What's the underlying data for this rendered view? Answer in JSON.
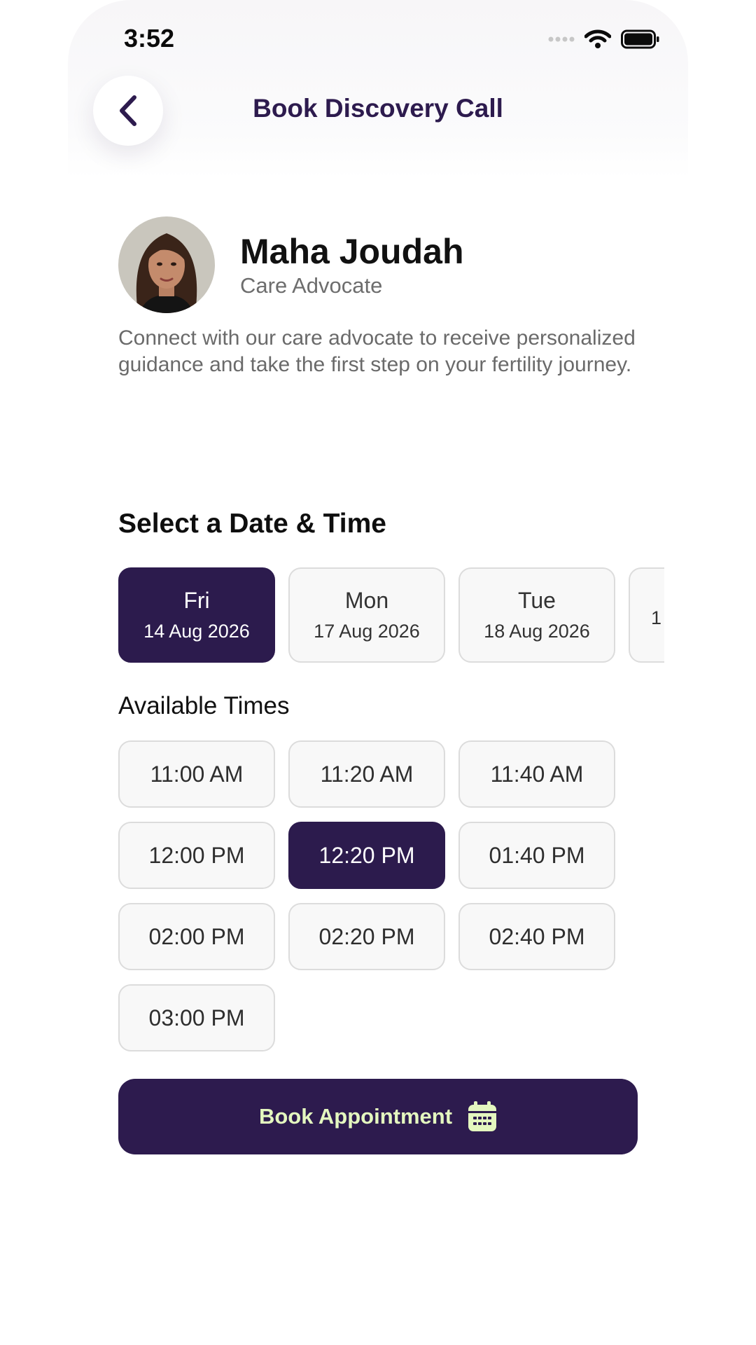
{
  "status_bar": {
    "time": "3:52"
  },
  "header": {
    "title": "Book Discovery Call"
  },
  "advocate": {
    "name": "Maha Joudah",
    "role": "Care Advocate",
    "description": "Connect with our care advocate to receive personalized guidance and take the first step on your fertility journey."
  },
  "date_section": {
    "title": "Select a Date & Time",
    "dates": [
      {
        "day": "Fri",
        "date": "14 Aug 2026",
        "selected": true
      },
      {
        "day": "Mon",
        "date": "17 Aug 2026",
        "selected": false
      },
      {
        "day": "Tue",
        "date": "18 Aug 2026",
        "selected": false
      },
      {
        "day": "",
        "date": "1",
        "selected": false
      }
    ]
  },
  "times_section": {
    "title": "Available Times",
    "slots": [
      {
        "label": "11:00 AM",
        "selected": false
      },
      {
        "label": "11:20 AM",
        "selected": false
      },
      {
        "label": "11:40 AM",
        "selected": false
      },
      {
        "label": "12:00 PM",
        "selected": false
      },
      {
        "label": "12:20 PM",
        "selected": true
      },
      {
        "label": "01:40 PM",
        "selected": false
      },
      {
        "label": "02:00 PM",
        "selected": false
      },
      {
        "label": "02:20 PM",
        "selected": false
      },
      {
        "label": "02:40 PM",
        "selected": false
      },
      {
        "label": "03:00 PM",
        "selected": false
      }
    ]
  },
  "book_button": {
    "label": "Book Appointment",
    "icon": "calendar-icon"
  },
  "colors": {
    "primary": "#2d1b4e",
    "accent": "#e4f7bf",
    "muted_text": "#6d6d6d",
    "card_border": "#dcdcdc"
  }
}
